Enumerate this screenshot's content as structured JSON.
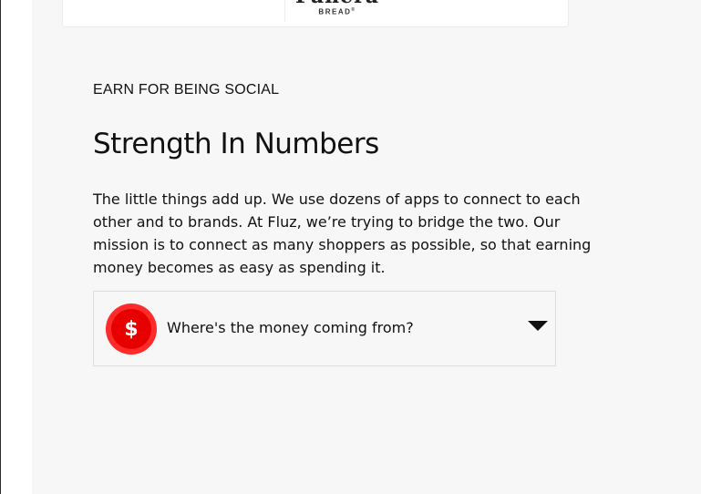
{
  "logos": {
    "panera_script": "Panera",
    "panera_sub": "BREAD",
    "panera_trademark": "®"
  },
  "section": {
    "eyebrow": "EARN FOR BEING SOCIAL",
    "title": "Strength In Numbers",
    "body_lines": [
      "The little things add up. We use dozens of apps to connect to each",
      "other and to brands. At Fluz, we’re trying to bridge the two. Our",
      "mission is to connect as many shoppers as possible, so that earning",
      "money becomes as easy as spending it."
    ]
  },
  "accordion": {
    "icon_name": "dollar-icon",
    "icon_glyph": "$",
    "label": "Where's the money coming from?",
    "toggle_icon": "caret-down-icon",
    "expanded": false,
    "badge_color": "#e60000"
  }
}
